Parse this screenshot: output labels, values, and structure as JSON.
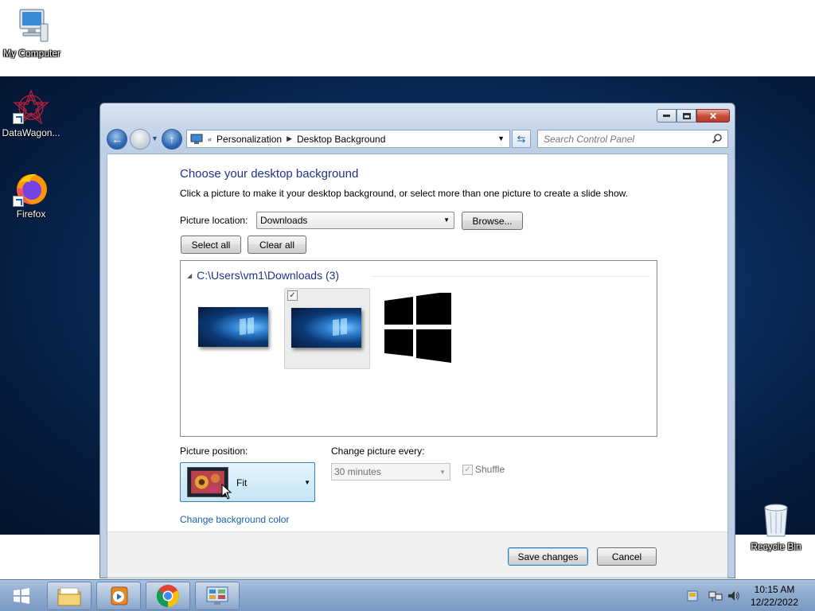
{
  "desktop": {
    "icons": [
      {
        "label": "My Computer"
      },
      {
        "label": "DataWagon..."
      },
      {
        "label": "Firefox"
      },
      {
        "label": "Recycle Bin"
      }
    ]
  },
  "window": {
    "breadcrumb": [
      "Personalization",
      "Desktop Background"
    ],
    "search_placeholder": "Search Control Panel",
    "title": "Choose your desktop background",
    "subtitle": "Click a picture to make it your desktop background, or select more than one picture to create a slide show.",
    "picture_location_label": "Picture location:",
    "picture_location_value": "Downloads",
    "browse_label": "Browse...",
    "select_all_label": "Select all",
    "clear_all_label": "Clear all",
    "gallery": {
      "group_title": "C:\\Users\\vm1\\Downloads (3)",
      "items": [
        {
          "checked": false,
          "selected": false
        },
        {
          "checked": true,
          "selected": true
        },
        {
          "checked": false,
          "selected": false
        }
      ]
    },
    "picture_position_label": "Picture position:",
    "picture_position_value": "Fit",
    "change_every_label": "Change picture every:",
    "change_every_value": "30 minutes",
    "shuffle_label": "Shuffle",
    "change_color_link": "Change background color",
    "save_label": "Save changes",
    "cancel_label": "Cancel"
  },
  "taskbar": {
    "time": "10:15 AM",
    "date": "12/22/2022",
    "accent": "#1e3287"
  }
}
